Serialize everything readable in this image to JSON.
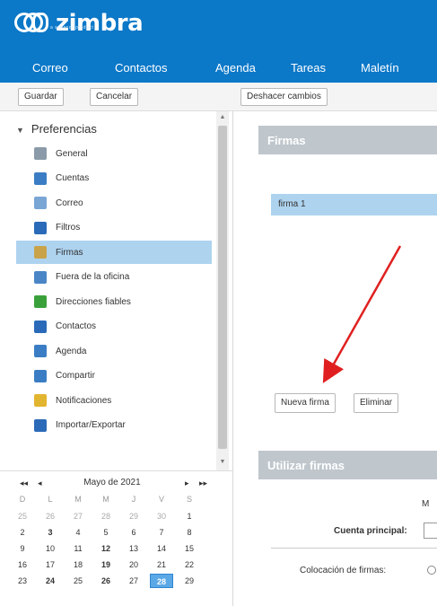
{
  "header": {
    "logo_text": "zimbra",
    "logo_subtext": "a synacor product",
    "tabs": [
      "Correo",
      "Contactos",
      "Agenda",
      "Tareas",
      "Maletín"
    ]
  },
  "toolbar": {
    "save_label": "Guardar",
    "cancel_label": "Cancelar",
    "undo_label": "Deshacer cambios"
  },
  "sidebar": {
    "title": "Preferencias",
    "items": [
      {
        "label": "General",
        "icon": "gear-icon",
        "color": "#8a9aa8"
      },
      {
        "label": "Cuentas",
        "icon": "users-icon",
        "color": "#3b7dc4"
      },
      {
        "label": "Correo",
        "icon": "mail-icon",
        "color": "#7aa6d6"
      },
      {
        "label": "Filtros",
        "icon": "filter-icon",
        "color": "#2a6ab8"
      },
      {
        "label": "Firmas",
        "icon": "signature-icon",
        "color": "#c9a34a"
      },
      {
        "label": "Fuera de la oficina",
        "icon": "away-icon",
        "color": "#4a86c6"
      },
      {
        "label": "Direcciones fiables",
        "icon": "shield-icon",
        "color": "#3aa13a"
      },
      {
        "label": "Contactos",
        "icon": "contact-icon",
        "color": "#2a6ab8"
      },
      {
        "label": "Agenda",
        "icon": "calendar-icon",
        "color": "#3b7dc4"
      },
      {
        "label": "Compartir",
        "icon": "share-icon",
        "color": "#3b7dc4"
      },
      {
        "label": "Notificaciones",
        "icon": "bell-icon",
        "color": "#e2b531"
      },
      {
        "label": "Importar/Exportar",
        "icon": "import-export-icon",
        "color": "#2a6ab8"
      }
    ],
    "selected_index": 4
  },
  "calendar": {
    "title": "Mayo de 2021",
    "nav_prev_year": "◂◂",
    "nav_prev": "◂",
    "nav_next": "▸",
    "nav_next_year": "▸▸",
    "weekdays": [
      "D",
      "L",
      "M",
      "M",
      "J",
      "V",
      "S"
    ],
    "weeks": [
      [
        "25",
        "26",
        "27",
        "28",
        "29",
        "30",
        "1"
      ],
      [
        "2",
        "3",
        "4",
        "5",
        "6",
        "7",
        "8"
      ],
      [
        "9",
        "10",
        "11",
        "12",
        "13",
        "14",
        "15"
      ],
      [
        "16",
        "17",
        "18",
        "19",
        "20",
        "21",
        "22"
      ],
      [
        "23",
        "24",
        "25",
        "26",
        "27",
        "28",
        "29"
      ]
    ],
    "today": "28"
  },
  "main": {
    "signatures_title": "Firmas",
    "signature_items": [
      "firma 1"
    ],
    "new_signature_label": "Nueva firma",
    "delete_label": "Eliminar",
    "use_signatures_title": "Utilizar firmas",
    "partial_label": "M",
    "primary_account_label": "Cuenta principal:",
    "placement_label": "Colocación de firmas:"
  },
  "colors": {
    "header_bg": "#0b78c8",
    "selected_row": "#aed3ef",
    "section_head": "#bfc6cc",
    "arrow": "#e02020"
  }
}
